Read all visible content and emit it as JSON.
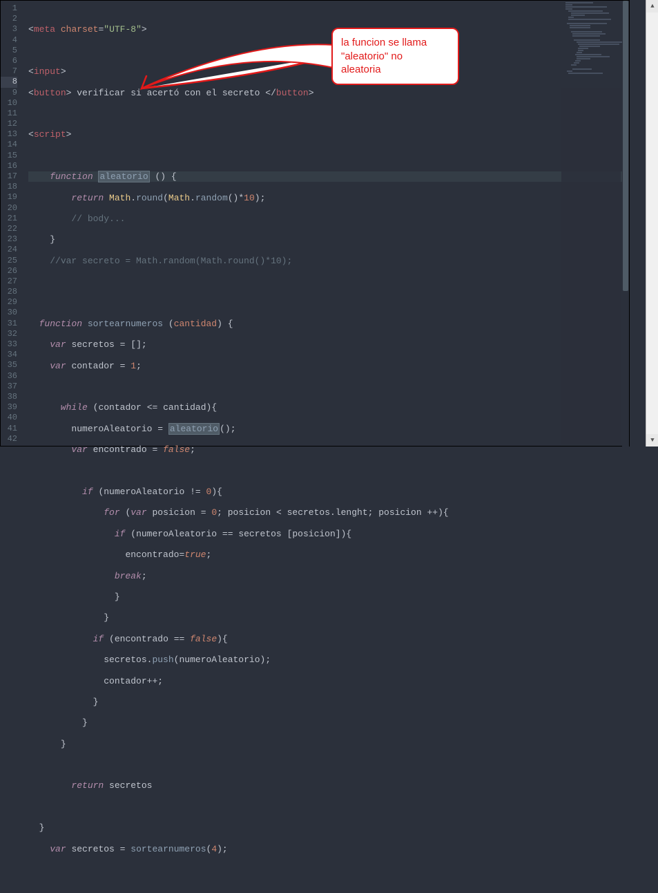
{
  "editor": {
    "lineStart": 1,
    "lineEnd": 42,
    "activeLine": 8
  },
  "code": {
    "l1": {
      "tag1": "meta",
      "attr": "charset",
      "val": "\"UTF-8\""
    },
    "l3": {
      "tag": "input"
    },
    "l4": {
      "tag": "button",
      "text": " verificar si acertó con el secreto "
    },
    "l6": {
      "tag": "script"
    },
    "l8": {
      "kw": "function",
      "name": "aleatorio",
      "paren": "() {"
    },
    "l9": {
      "kw": "return",
      "obj": "Math",
      "m1": "round",
      "obj2": "Math",
      "m2": "random",
      "rest": "()*",
      "num": "10",
      "end": ");"
    },
    "l10": {
      "cm": "// body..."
    },
    "l11": {
      "brace": "}"
    },
    "l12": {
      "cm": "//var secreto = Math.random(Math.round()*10);"
    },
    "l15": {
      "kw": "function",
      "name": "sortearnumeros",
      "arg": "cantidad",
      "rest": ") {"
    },
    "l16": {
      "kw": "var",
      "name": "secretos",
      "val": "[];"
    },
    "l17": {
      "kw": "var",
      "name": "contador",
      "num": "1",
      "end": ";"
    },
    "l19": {
      "kw": "while",
      "a": "contador",
      "op": "<=",
      "b": "cantidad",
      "end": "){"
    },
    "l20": {
      "a": "numeroAleatorio",
      "fn": "aleatorio",
      "end": "();"
    },
    "l21": {
      "kw": "var",
      "name": "encontrado",
      "val": "false",
      "end": ";"
    },
    "l23": {
      "kw": "if",
      "a": "numeroAleatorio",
      "op": "!=",
      "num": "0",
      "end": "){"
    },
    "l24": {
      "kw": "for",
      "kw2": "var",
      "a": "posicion",
      "num0": "0",
      "b": "posicion",
      "op": "<",
      "c": "secretos",
      "prop": "lenght",
      "d": "posicion",
      "op2": "++",
      "end": "){"
    },
    "l25": {
      "kw": "if",
      "a": "numeroAleatorio",
      "op": "==",
      "b": "secretos",
      "c": "posicion",
      "end": "]){"
    },
    "l26": {
      "a": "encontrado",
      "val": "true",
      "end": ";"
    },
    "l27": {
      "kw": "break",
      "end": ";"
    },
    "l28": {
      "brace": "}"
    },
    "l29": {
      "brace": "}"
    },
    "l30": {
      "kw": "if",
      "a": "encontrado",
      "op": "==",
      "val": "false",
      "end": "){"
    },
    "l31": {
      "a": "secretos",
      "fn": "push",
      "b": "numeroAleatorio",
      "end": ");"
    },
    "l32": {
      "a": "contador",
      "op": "++",
      "end": ";"
    },
    "l33": {
      "brace": "}"
    },
    "l34": {
      "brace": "}"
    },
    "l35": {
      "brace": "}"
    },
    "l37": {
      "kw": "return",
      "a": "secretos"
    },
    "l39": {
      "brace": "}"
    },
    "l40": {
      "kw": "var",
      "a": "secretos",
      "fn": "sortearnumeros",
      "num": "4",
      "end": ");"
    }
  },
  "callout": {
    "text1": "la funcion se llama",
    "text2": "\"aleatorio\" no",
    "text3": "aleatoria"
  }
}
